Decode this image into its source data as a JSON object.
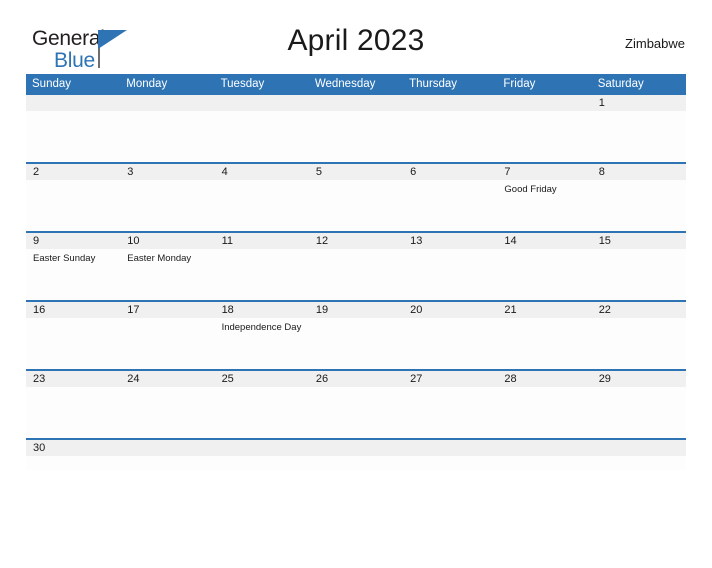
{
  "brand": {
    "name_part1": "General",
    "name_part2": "Blue",
    "flag_icon": "blue-triangle-flag-icon",
    "accent_color": "#2e74b5"
  },
  "header": {
    "title": "April 2023",
    "region": "Zimbabwe"
  },
  "calendar": {
    "month": "April",
    "year": "2023",
    "header_bg": "#2e74b5",
    "date_band_bg": "#f0f0f0",
    "weekday_headers": [
      "Sunday",
      "Monday",
      "Tuesday",
      "Wednesday",
      "Thursday",
      "Friday",
      "Saturday"
    ],
    "weeks": [
      {
        "days": [
          {
            "date": "",
            "event": ""
          },
          {
            "date": "",
            "event": ""
          },
          {
            "date": "",
            "event": ""
          },
          {
            "date": "",
            "event": ""
          },
          {
            "date": "",
            "event": ""
          },
          {
            "date": "",
            "event": ""
          },
          {
            "date": "1",
            "event": ""
          }
        ]
      },
      {
        "days": [
          {
            "date": "2",
            "event": ""
          },
          {
            "date": "3",
            "event": ""
          },
          {
            "date": "4",
            "event": ""
          },
          {
            "date": "5",
            "event": ""
          },
          {
            "date": "6",
            "event": ""
          },
          {
            "date": "7",
            "event": "Good Friday"
          },
          {
            "date": "8",
            "event": ""
          }
        ]
      },
      {
        "days": [
          {
            "date": "9",
            "event": "Easter Sunday"
          },
          {
            "date": "10",
            "event": "Easter Monday"
          },
          {
            "date": "11",
            "event": ""
          },
          {
            "date": "12",
            "event": ""
          },
          {
            "date": "13",
            "event": ""
          },
          {
            "date": "14",
            "event": ""
          },
          {
            "date": "15",
            "event": ""
          }
        ]
      },
      {
        "days": [
          {
            "date": "16",
            "event": ""
          },
          {
            "date": "17",
            "event": ""
          },
          {
            "date": "18",
            "event": "Independence Day"
          },
          {
            "date": "19",
            "event": ""
          },
          {
            "date": "20",
            "event": ""
          },
          {
            "date": "21",
            "event": ""
          },
          {
            "date": "22",
            "event": ""
          }
        ]
      },
      {
        "days": [
          {
            "date": "23",
            "event": ""
          },
          {
            "date": "24",
            "event": ""
          },
          {
            "date": "25",
            "event": ""
          },
          {
            "date": "26",
            "event": ""
          },
          {
            "date": "27",
            "event": ""
          },
          {
            "date": "28",
            "event": ""
          },
          {
            "date": "29",
            "event": ""
          }
        ]
      },
      {
        "days": [
          {
            "date": "30",
            "event": ""
          },
          {
            "date": "",
            "event": ""
          },
          {
            "date": "",
            "event": ""
          },
          {
            "date": "",
            "event": ""
          },
          {
            "date": "",
            "event": ""
          },
          {
            "date": "",
            "event": ""
          },
          {
            "date": "",
            "event": ""
          }
        ]
      }
    ]
  }
}
